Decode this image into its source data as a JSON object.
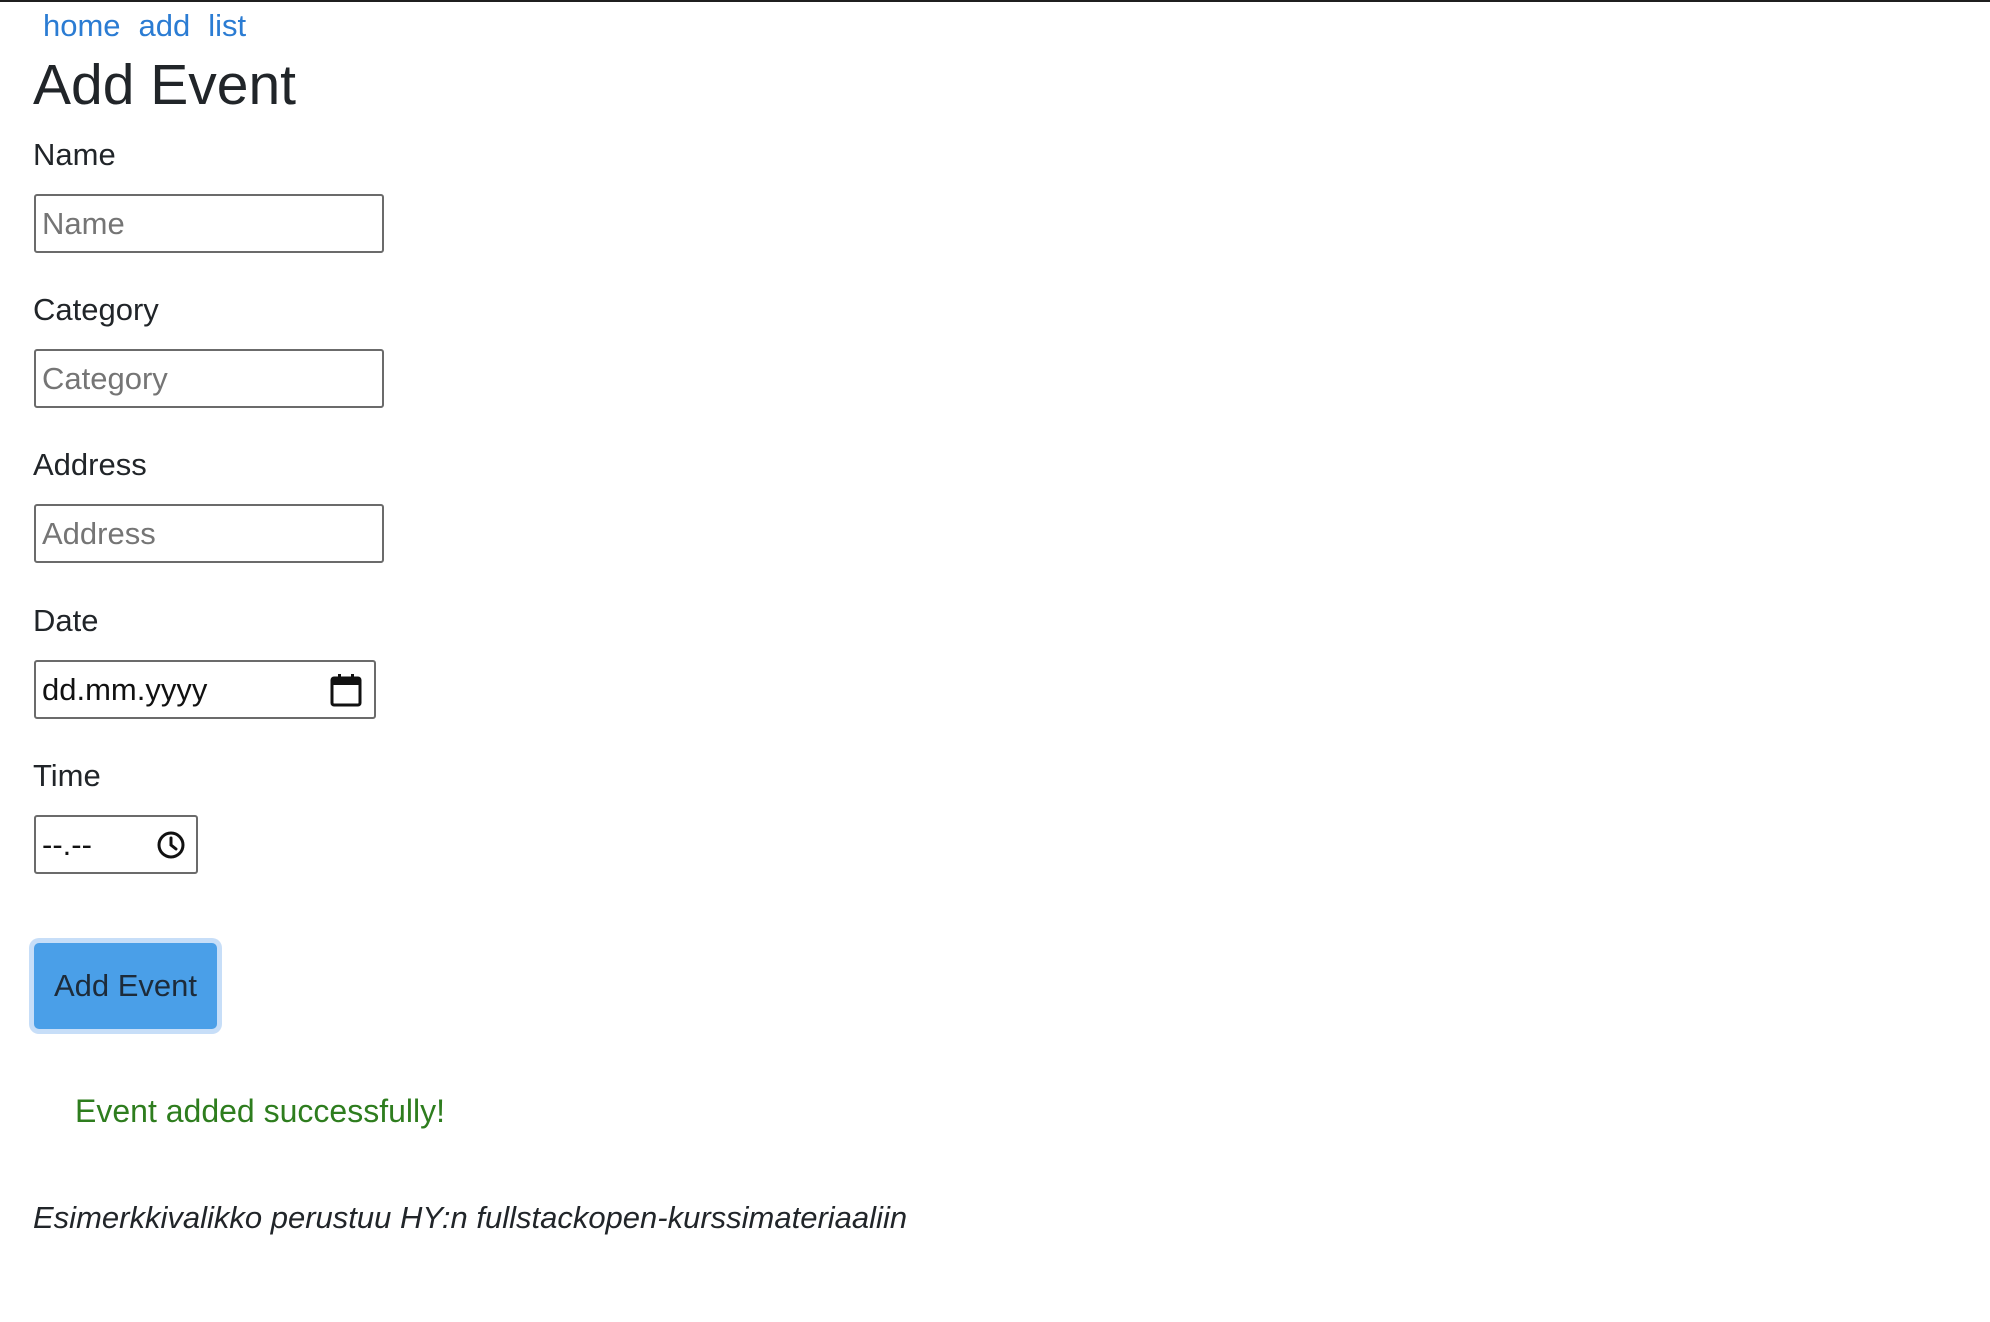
{
  "nav": {
    "links": [
      "home",
      "add",
      "list"
    ]
  },
  "page": {
    "title": "Add Event"
  },
  "form": {
    "name": {
      "label": "Name",
      "placeholder": "Name",
      "value": ""
    },
    "category": {
      "label": "Category",
      "placeholder": "Category",
      "value": ""
    },
    "address": {
      "label": "Address",
      "placeholder": "Address",
      "value": ""
    },
    "date": {
      "label": "Date",
      "display": "dd.mm.yyyy",
      "icon": "calendar-icon"
    },
    "time": {
      "label": "Time",
      "display": "--.--",
      "icon": "clock-icon"
    },
    "submit_label": "Add Event"
  },
  "notification": {
    "message": "Event added successfully!",
    "color": "#2e7d1e"
  },
  "footer": {
    "text": "Esimerkkivalikko perustuu HY:n fullstackopen-kurssimateriaaliin"
  },
  "colors": {
    "link": "#2b7cd3",
    "button": "#4a9fe8",
    "button_focus_ring": "#c7def8"
  }
}
